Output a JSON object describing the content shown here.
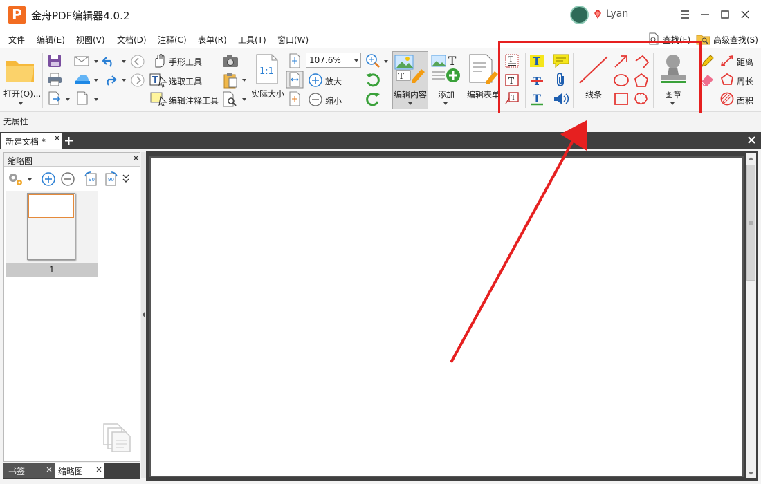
{
  "app": {
    "title": "金舟PDF编辑器4.0.2",
    "logo_letter": "P",
    "user_name": "Lyan"
  },
  "menu": [
    "文件",
    "编辑(E)",
    "视图(V)",
    "文档(D)",
    "注释(C)",
    "表单(R)",
    "工具(T)",
    "窗口(W)"
  ],
  "find": {
    "find_label": "查找(F)",
    "advanced_find_label": "高级查找(S)"
  },
  "ribbon": {
    "open_label": "打开(O)...",
    "hand_tool": "手形工具",
    "select_tool": "选取工具",
    "edit_annotation_tool": "编辑注释工具",
    "actual_size": "实际大小",
    "zoom_value": "107.6%",
    "zoom_in": "放大",
    "zoom_out": "缩小",
    "edit_content": "编辑内容",
    "add": "添加",
    "edit_form": "编辑表单",
    "lines": "线条",
    "stamp": "图章",
    "distance": "距离",
    "perimeter": "周长",
    "area": "面积"
  },
  "props_bar": {
    "label": "无属性"
  },
  "tabs": {
    "doc_tab": "新建文档 *"
  },
  "side_panel": {
    "title": "缩略图",
    "page_number": "1",
    "tab_bookmark": "书签",
    "tab_thumbnails": "缩略图"
  },
  "colors": {
    "accent_red": "#e62020",
    "logo_orange": "#f26c21"
  }
}
